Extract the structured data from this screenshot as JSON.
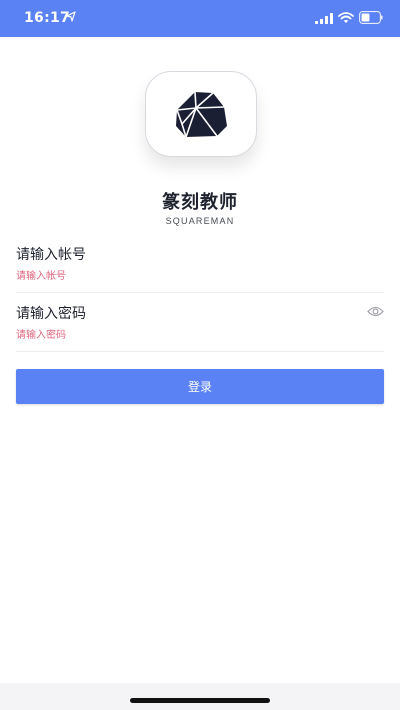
{
  "status_bar": {
    "time": "16:17",
    "background_color": "#5b82f4",
    "icons": [
      "location-arrow-icon",
      "cellular-signal-icon",
      "wifi-icon",
      "battery-icon"
    ]
  },
  "app": {
    "logo_icon": "faceted-gem-logo",
    "title": "篆刻教师",
    "subtitle": "SQUAREMAN"
  },
  "login_form": {
    "account": {
      "label": "请输入帐号",
      "hint": "请输入帐号",
      "value": ""
    },
    "password": {
      "label": "请输入密码",
      "hint": "请输入密码",
      "value": "",
      "visibility_icon": "eye-icon"
    },
    "submit_label": "登录"
  },
  "colors": {
    "accent": "#5b82f4",
    "hint": "#e0667d",
    "text": "#1f2330"
  }
}
